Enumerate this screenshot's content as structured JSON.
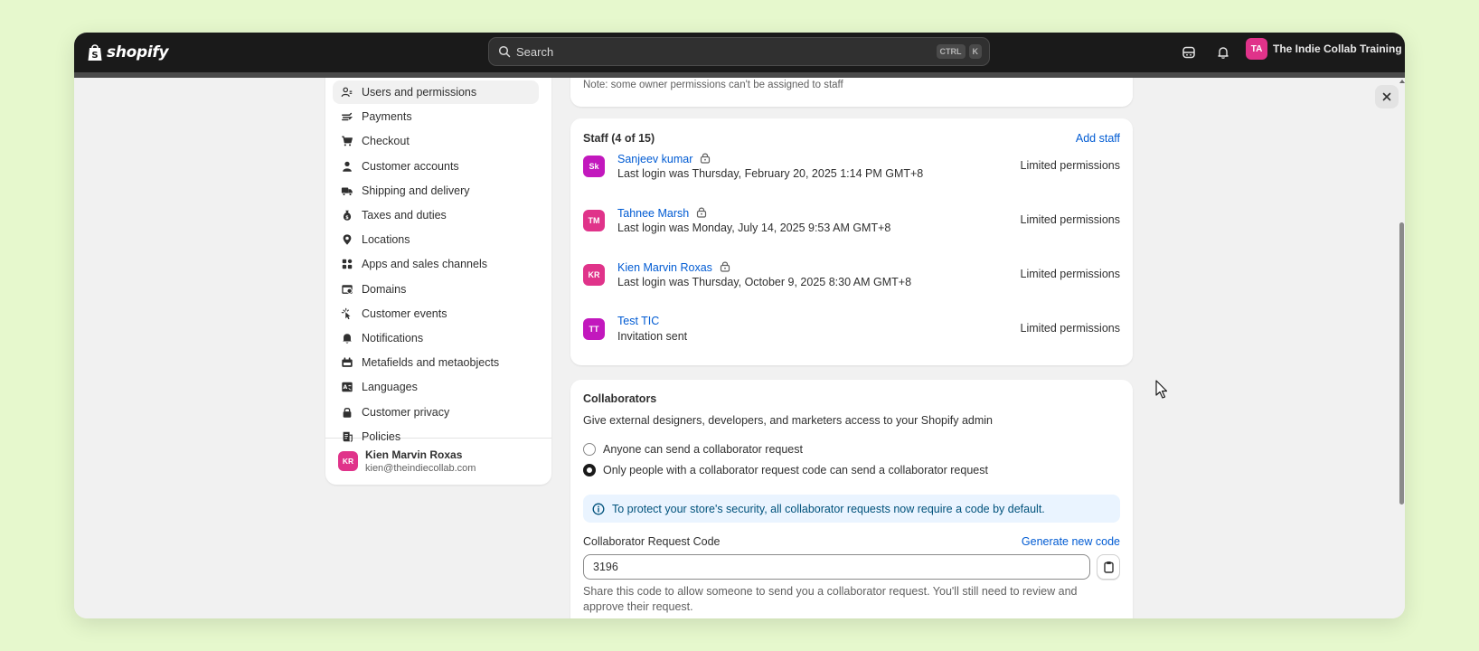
{
  "topbar": {
    "logo_text": "shopify",
    "search_placeholder": "Search",
    "shortcut_keys": [
      "CTRL",
      "K"
    ],
    "store_initials": "TA",
    "store_name": "The Indie Collab Training ..."
  },
  "sidebar": {
    "items": [
      {
        "label": "Users and permissions",
        "icon": "users-icon",
        "active": true
      },
      {
        "label": "Payments",
        "icon": "payments-icon"
      },
      {
        "label": "Checkout",
        "icon": "cart-icon"
      },
      {
        "label": "Customer accounts",
        "icon": "person-icon"
      },
      {
        "label": "Shipping and delivery",
        "icon": "truck-icon"
      },
      {
        "label": "Taxes and duties",
        "icon": "money-bag-icon"
      },
      {
        "label": "Locations",
        "icon": "location-pin-icon"
      },
      {
        "label": "Apps and sales channels",
        "icon": "apps-icon"
      },
      {
        "label": "Domains",
        "icon": "globe-window-icon"
      },
      {
        "label": "Customer events",
        "icon": "cursor-click-icon"
      },
      {
        "label": "Notifications",
        "icon": "bell-icon"
      },
      {
        "label": "Metafields and metaobjects",
        "icon": "metafields-icon"
      },
      {
        "label": "Languages",
        "icon": "language-icon"
      },
      {
        "label": "Customer privacy",
        "icon": "lock-icon"
      },
      {
        "label": "Policies",
        "icon": "policy-icon"
      }
    ],
    "user": {
      "initials": "KR",
      "name": "Kien Marvin Roxas",
      "email": "kien@theindiecollab.com"
    }
  },
  "note": {
    "text": "Note: some owner permissions can't be assigned to staff"
  },
  "staff": {
    "title": "Staff (4 of 15)",
    "add_label": "Add staff",
    "members": [
      {
        "initials": "Sk",
        "name": "Sanjeev kumar",
        "status": "Last login was Thursday, February 20, 2025 1:14 PM GMT+8",
        "permission": "Limited permissions",
        "color": "#c218bd",
        "locked": true
      },
      {
        "initials": "TM",
        "name": "Tahnee Marsh",
        "status": "Last login was Monday, July 14, 2025 9:53 AM GMT+8",
        "permission": "Limited permissions",
        "color": "#e0338a",
        "locked": true
      },
      {
        "initials": "KR",
        "name": "Kien Marvin Roxas",
        "status": "Last login was Thursday, October 9, 2025 8:30 AM GMT+8",
        "permission": "Limited permissions",
        "color": "#e0338a",
        "locked": true
      },
      {
        "initials": "TT",
        "name": "Test TIC",
        "status": "Invitation sent",
        "permission": "Limited permissions",
        "color": "#c218bd",
        "locked": false
      }
    ]
  },
  "collaborators": {
    "title": "Collaborators",
    "description": "Give external designers, developers, and marketers access to your Shopify admin",
    "options": [
      {
        "label": "Anyone can send a collaborator request",
        "selected": false
      },
      {
        "label": "Only people with a collaborator request code can send a collaborator request",
        "selected": true
      }
    ],
    "banner": "To protect your store's security, all collaborator requests now require a code by default.",
    "code_label": "Collaborator Request Code",
    "generate_label": "Generate new code",
    "code_value": "3196",
    "help_text": "Share this code to allow someone to send you a collaborator request. You'll still need to review and approve their request."
  },
  "colors": {
    "accent_link": "#005bd3",
    "topbar": "#1a1a1a",
    "background": "#e6f8cd",
    "avatar_pink": "#e0338a",
    "avatar_magenta": "#c218bd"
  }
}
